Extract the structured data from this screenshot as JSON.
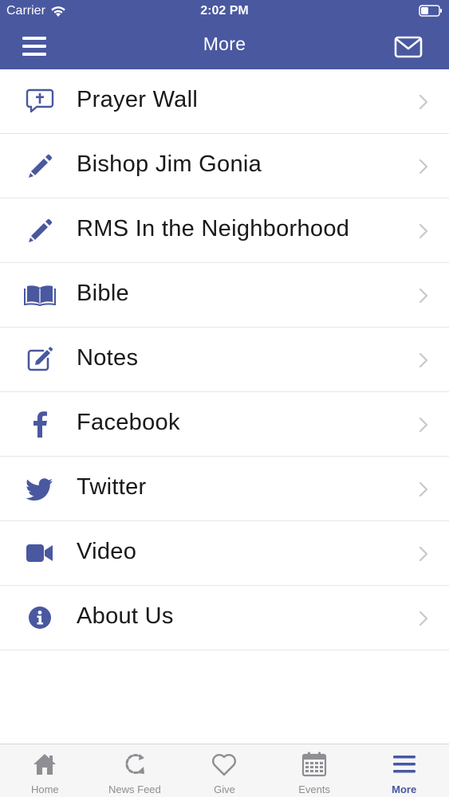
{
  "status_bar": {
    "carrier": "Carrier",
    "time": "2:02 PM"
  },
  "nav": {
    "title": "More",
    "menu_icon": "hamburger-menu-icon",
    "mail_icon": "envelope-icon"
  },
  "colors": {
    "brand": "#4a58a0",
    "icon": "#4a58a0",
    "text": "#1a1a1a",
    "chevron": "#c7c7cc",
    "tab_inactive": "#8e8e93"
  },
  "menu_items": [
    {
      "label": "Prayer Wall",
      "icon": "prayer-bubble-icon"
    },
    {
      "label": "Bishop Jim Gonia",
      "icon": "pencil-icon"
    },
    {
      "label": "RMS In the Neighborhood",
      "icon": "pencil-icon"
    },
    {
      "label": "Bible",
      "icon": "open-book-icon"
    },
    {
      "label": "Notes",
      "icon": "notes-edit-icon"
    },
    {
      "label": "Facebook",
      "icon": "facebook-icon"
    },
    {
      "label": "Twitter",
      "icon": "twitter-icon"
    },
    {
      "label": "Video",
      "icon": "video-camera-icon"
    },
    {
      "label": "About Us",
      "icon": "info-icon"
    }
  ],
  "tabs": [
    {
      "label": "Home",
      "icon": "home-icon",
      "active": false
    },
    {
      "label": "News Feed",
      "icon": "refresh-feed-icon",
      "active": false
    },
    {
      "label": "Give",
      "icon": "heart-icon",
      "active": false
    },
    {
      "label": "Events",
      "icon": "calendar-icon",
      "active": false
    },
    {
      "label": "More",
      "icon": "hamburger-menu-icon",
      "active": true
    }
  ]
}
